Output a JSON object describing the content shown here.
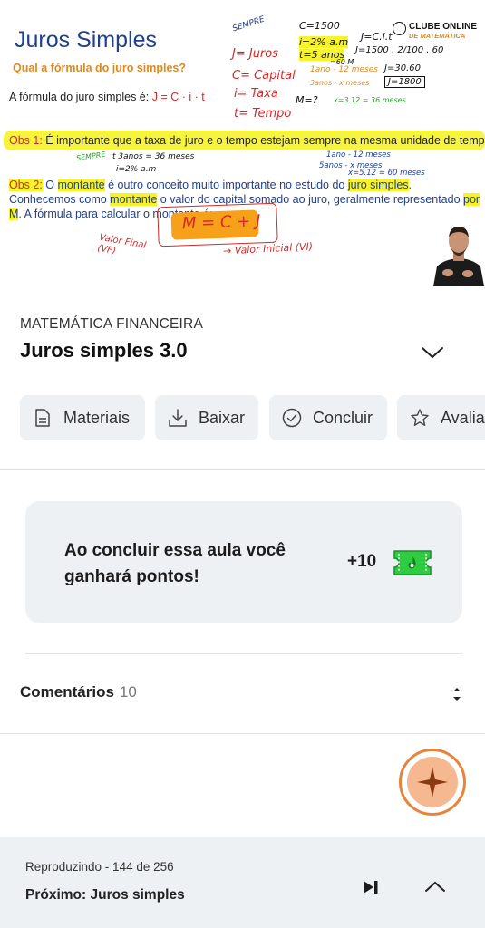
{
  "video": {
    "slide_title": "Juros Simples",
    "question": "Qual a fórmula do juro simples?",
    "formula_prefix": "A fórmula do juro simples é: ",
    "formula": "J = C · i · t",
    "obs1_label": "Obs 1:",
    "obs1_text": " É importante que a taxa de juro e o tempo estejam sempre na mesma unidade de tempo.",
    "obs2_label": "Obs 2:",
    "obs2_text_a": " O ",
    "obs2_hl1": "montante",
    "obs2_text_b": " é outro conceito muito importante no estudo do ",
    "obs2_hl2": "juro simples",
    "obs2_text_c": ". Conhecemos como ",
    "obs2_hl3": "montante",
    "obs2_text_d": " o valor do capital somado ao juro, geralmente representado ",
    "obs2_hl4": "por M",
    "obs2_text_e": ". A fórmula para calcular o montante é:",
    "logo_line1": "CLUBE ONLINE",
    "logo_line2": "DE MATEMÁTICA",
    "notes": {
      "sempre": "SEMPRE",
      "j_juros": "J= Juros",
      "c_capital": "C= Capital",
      "i_taxa": "i= Taxa",
      "t_tempo": "t= Tempo",
      "c1500": "C=1500",
      "i2": "i=2% a.m",
      "t5": "t=5 anos",
      "t60": "=60 M",
      "ano12": "1ano - 12 meses",
      "anos3": "3anos - x meses",
      "x36": "x=3.12 = 36 meses",
      "m_q": "M=?",
      "j_cit": "J=C.i.t",
      "j_calc": "J=1500 . 2/100 . 60",
      "j_30": "J=30.60",
      "j_1800": "J=1800",
      "sempre2": "SEMPRE",
      "t3anos": "t 3anos = 36 meses",
      "i2am": "i=2% a.m",
      "ano12b": "1ano - 12 meses",
      "anos5": "5anos - x meses",
      "x60": "x=5.12 = 60 meses",
      "m_formula": "M = C + J",
      "valor_final": "Valor Final (VF)",
      "valor_inicial": "→ Valor Inicial (VI)"
    }
  },
  "lesson": {
    "course": "MATEMÁTICA FINANCEIRA",
    "title": "Juros simples 3.0"
  },
  "actions": [
    {
      "label": "Materiais",
      "icon": "document-icon"
    },
    {
      "label": "Baixar",
      "icon": "download-icon"
    },
    {
      "label": "Concluir",
      "icon": "check-circle-icon"
    },
    {
      "label": "Avaliar",
      "icon": "star-icon"
    }
  ],
  "points": {
    "message": "Ao concluir essa aula você ganhará pontos!",
    "value": "+10",
    "ticket_color": "#2ecc40"
  },
  "comments": {
    "label": "Comentários",
    "count": "10"
  },
  "player": {
    "playing": "Reproduzindo - 144 de 256",
    "next": "Próximo: Juros simples"
  },
  "colors": {
    "accent": "#e8833a",
    "surface": "#eef1f3",
    "highlight": "#f6f32a",
    "slide_blue": "#1f3f8f",
    "ink_red": "#d42a2a"
  }
}
